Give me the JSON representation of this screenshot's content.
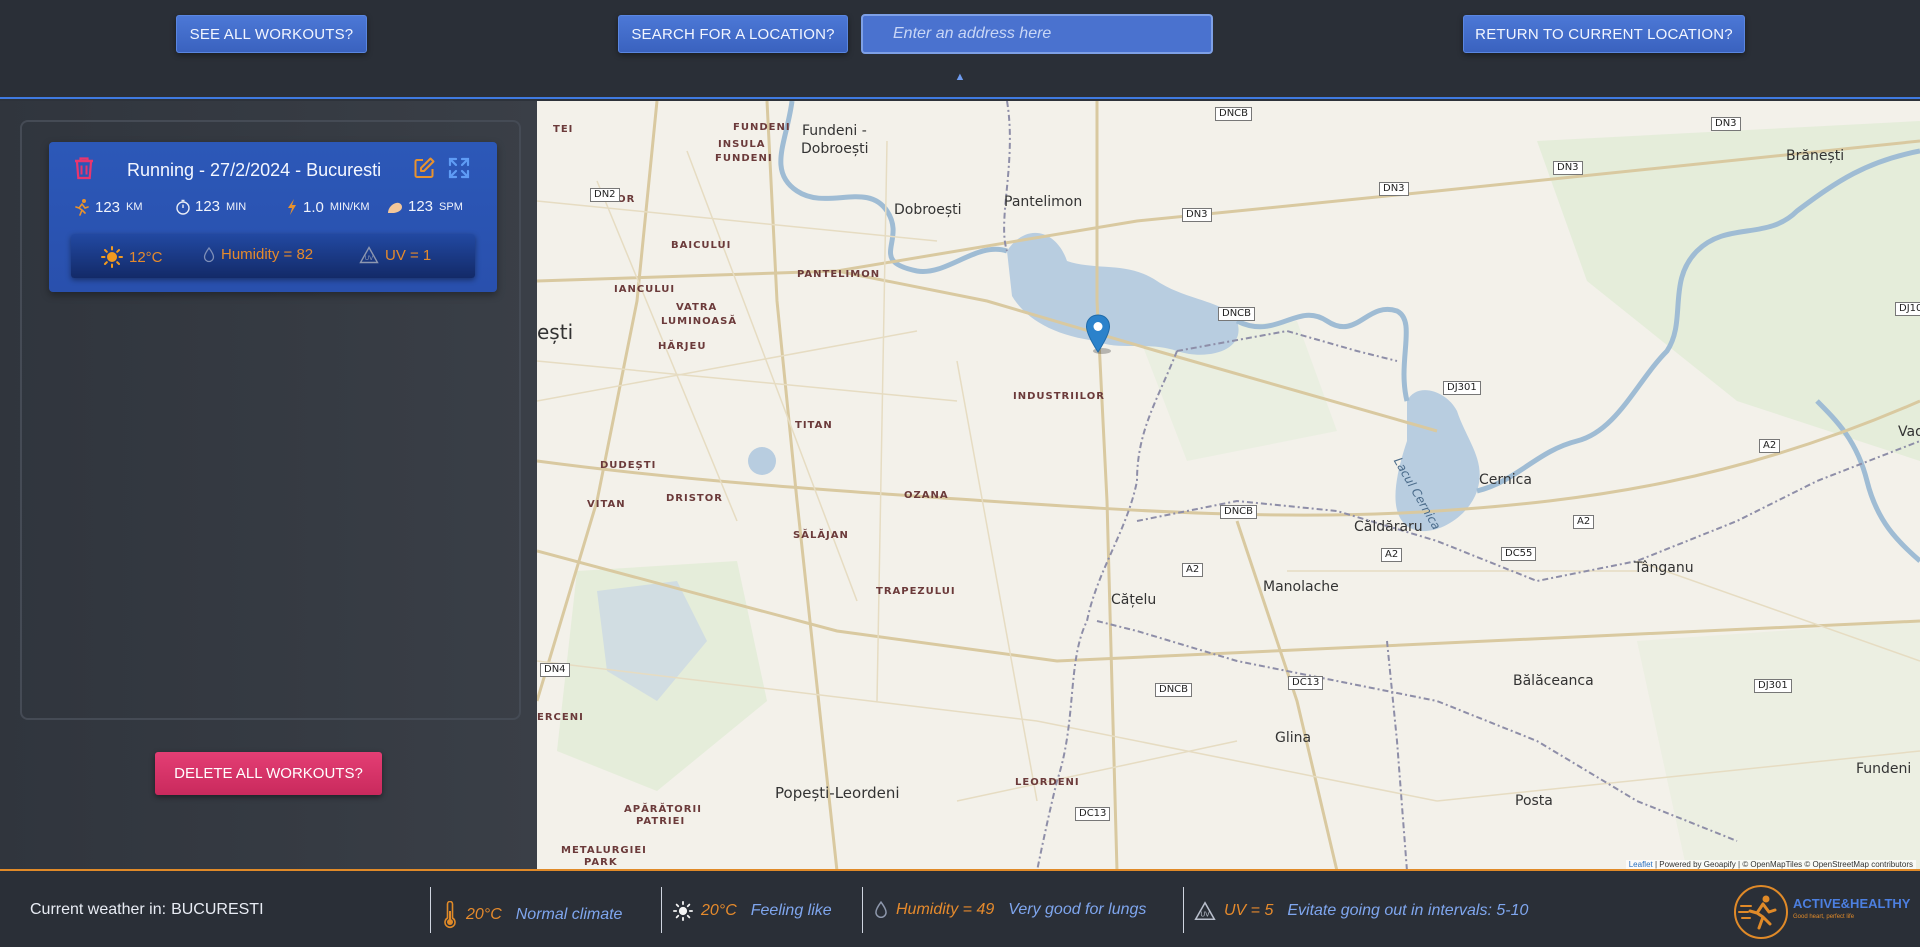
{
  "header": {
    "see_all_label": "SEE ALL WORKOUTS?",
    "search_label": "SEARCH FOR A LOCATION?",
    "search_placeholder": "Enter an address here",
    "return_label": "RETURN TO CURRENT LOCATION?",
    "collapse_glyph": "▲"
  },
  "sidebar": {
    "workouts": [
      {
        "title": "Running - 27/2/2024 - Bucuresti",
        "distance": "123",
        "distance_unit": "km",
        "duration": "123",
        "duration_unit": "min",
        "pace": "1.0",
        "pace_unit": "min/km",
        "cadence": "123",
        "cadence_unit": "spm",
        "weather": {
          "temperature": "12°C",
          "humidity": "Humidity = 82",
          "uv": "UV = 1"
        }
      }
    ],
    "delete_all_label": "DELETE ALL WORKOUTS?"
  },
  "map": {
    "districts": [
      {
        "text": "FUNDENI",
        "id": "fundeni-d"
      },
      {
        "text": "INSULA",
        "id": "insula"
      },
      {
        "text": "FUNDENI",
        "id": "insula-fundeni"
      },
      {
        "text": "TEI",
        "id": "tei"
      },
      {
        "text": "OBOR",
        "id": "obor"
      },
      {
        "text": "BAICULUI",
        "id": "baicului"
      },
      {
        "text": "PANTELIMON",
        "id": "pantelimon-d"
      },
      {
        "text": "IANCULUI",
        "id": "iancului"
      },
      {
        "text": "VATRA",
        "id": "vatra"
      },
      {
        "text": "LUMINOASĂ",
        "id": "luminoasa"
      },
      {
        "text": "HĂRJEU",
        "id": "harjeu"
      },
      {
        "text": "INDUSTRIILOR",
        "id": "industriilor"
      },
      {
        "text": "TITAN",
        "id": "titan"
      },
      {
        "text": "DUDEȘTI",
        "id": "dudesti"
      },
      {
        "text": "VITAN",
        "id": "vitan"
      },
      {
        "text": "DRISTOR",
        "id": "dristor"
      },
      {
        "text": "OZANA",
        "id": "ozana"
      },
      {
        "text": "SĂLĂJAN",
        "id": "salajan"
      },
      {
        "text": "TRAPEZULUI",
        "id": "trapezului"
      },
      {
        "text": "ERCENI",
        "id": "erceni"
      },
      {
        "text": "LEORDENI",
        "id": "leordeni"
      },
      {
        "text": "APĂRĂTORII",
        "id": "aparatorii"
      },
      {
        "text": "PATRIEI",
        "id": "patriei"
      },
      {
        "text": "METALURGIEI",
        "id": "metalurgiei"
      },
      {
        "text": "PARK",
        "id": "park"
      }
    ],
    "towns": [
      {
        "text": "Fundeni -",
        "id": "fundeni-dob-1"
      },
      {
        "text": "Dobroești",
        "id": "fundeni-dob-2"
      },
      {
        "text": "Pantelimon",
        "id": "pantelimon-t"
      },
      {
        "text": "Dobroești",
        "id": "dobroesti"
      },
      {
        "text": "ești",
        "id": "bucuresti-partial"
      },
      {
        "text": "Brănești",
        "id": "branesti"
      },
      {
        "text": "Cernica",
        "id": "cernica"
      },
      {
        "text": "Căldăraru",
        "id": "caldararu"
      },
      {
        "text": "Manolache",
        "id": "manolache"
      },
      {
        "text": "Cățelu",
        "id": "catelu"
      },
      {
        "text": "Tânganu",
        "id": "tanganu"
      },
      {
        "text": "Vadu",
        "id": "vadu"
      },
      {
        "text": "Bălăceanca",
        "id": "balaceanca"
      },
      {
        "text": "Glina",
        "id": "glina"
      },
      {
        "text": "Popești-Leordeni",
        "id": "popesti"
      },
      {
        "text": "Fundeni",
        "id": "fundeni-e"
      },
      {
        "text": "Posta",
        "id": "posta"
      },
      {
        "text": "Lacul Cernica",
        "id": "lake"
      }
    ],
    "shields": [
      {
        "text": "DNCB",
        "id": "s1"
      },
      {
        "text": "DN3",
        "id": "s2"
      },
      {
        "text": "DN3",
        "id": "s3"
      },
      {
        "text": "DN3",
        "id": "s4"
      },
      {
        "text": "DN3",
        "id": "s5"
      },
      {
        "text": "DN2",
        "id": "s6"
      },
      {
        "text": "DNCB",
        "id": "s7"
      },
      {
        "text": "DJ301",
        "id": "s8"
      },
      {
        "text": "DJ10",
        "id": "s9"
      },
      {
        "text": "A2",
        "id": "s10"
      },
      {
        "text": "DNCB",
        "id": "s11"
      },
      {
        "text": "A2",
        "id": "s12"
      },
      {
        "text": "A2",
        "id": "s13"
      },
      {
        "text": "A2",
        "id": "s14"
      },
      {
        "text": "DC55",
        "id": "s15"
      },
      {
        "text": "DN4",
        "id": "s16"
      },
      {
        "text": "DNCB",
        "id": "s17"
      },
      {
        "text": "DC13",
        "id": "s18"
      },
      {
        "text": "DJ301",
        "id": "s19"
      },
      {
        "text": "DC13",
        "id": "s20"
      }
    ],
    "attribution_link": "Leaflet",
    "attribution_text": "| Powered by Geoapify | © OpenMapTiles © OpenStreetMap contributors"
  },
  "footer": {
    "current_label": "Current weather in:",
    "city": "BUCURESTI",
    "temp": "20°C",
    "climate": "Normal climate",
    "feels_temp": "20°C",
    "feels_label": "Feeling like",
    "humidity": "Humidity = 49",
    "humidity_note": "Very good for lungs",
    "uv": "UV = 5",
    "uv_note": "Evitate going out in intervals: 5-10",
    "logo_title": "ACTIVE&HEALTHY",
    "logo_sub": "Good heart, perfect life"
  },
  "colors": {
    "accent_blue": "#3f7ae0",
    "accent_orange": "#e08a28",
    "danger": "#d9336a"
  }
}
